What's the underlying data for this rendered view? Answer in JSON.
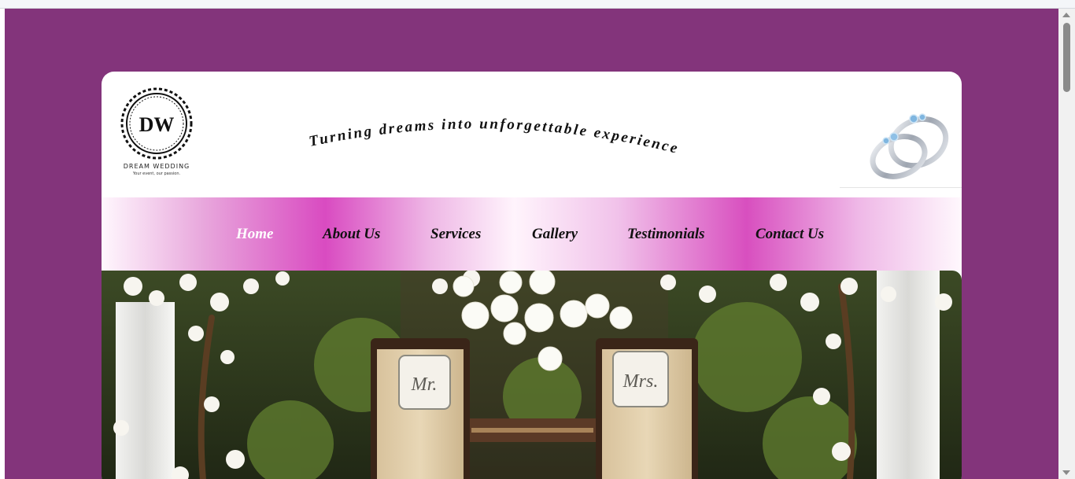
{
  "brand": {
    "logo_initials": "DW",
    "logo_name": "DREAM WEDDING",
    "logo_tagline": "Your event, our passion."
  },
  "header": {
    "tagline": "Turning dreams into unforgettable experiences.",
    "ring_icon": "wedding-rings-icon"
  },
  "nav": {
    "items": [
      {
        "label": "Home",
        "active": true
      },
      {
        "label": "About Us",
        "active": false
      },
      {
        "label": "Services",
        "active": false
      },
      {
        "label": "Gallery",
        "active": false
      },
      {
        "label": "Testimonials",
        "active": false
      },
      {
        "label": "Contact Us",
        "active": false
      }
    ]
  },
  "hero": {
    "chair_left_sign": "Mr.",
    "chair_right_sign": "Mrs."
  },
  "colors": {
    "page_background": "#83347b",
    "nav_accent": "#d94bc1",
    "card_background": "#ffffff"
  }
}
